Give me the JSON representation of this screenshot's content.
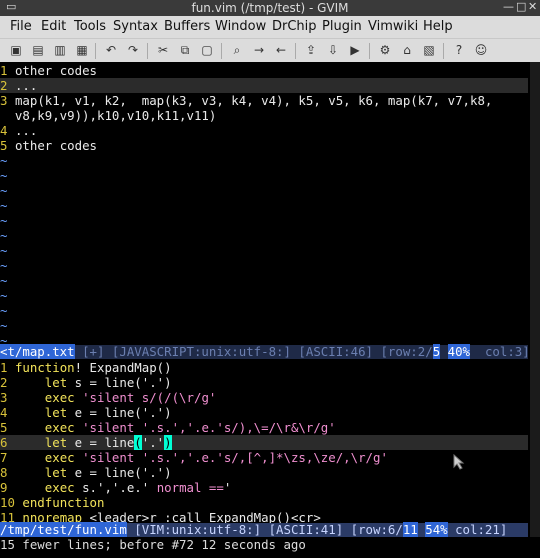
{
  "window": {
    "title": "fun.vim (/tmp/test) - GVIM"
  },
  "menus": [
    "File",
    "Edit",
    "Tools",
    "Syntax",
    "Buffers",
    "Window",
    "DrChip",
    "Plugin",
    "Vimwiki",
    "Help"
  ],
  "toolbar": {
    "icons": [
      "open-file-icon",
      "save-icon",
      "save-all-icon",
      "print-icon",
      "undo-icon",
      "redo-icon",
      "cut-icon",
      "copy-icon",
      "paste-icon",
      "find-icon",
      "find-next-icon",
      "find-prev-icon",
      "load-session-icon",
      "save-session-icon",
      "run-script-icon",
      "make-icon",
      "tag-icon",
      "help-icon",
      "find-help-icon"
    ]
  },
  "top_buffer": {
    "lines": [
      {
        "n": "1",
        "text": "other codes"
      },
      {
        "n": "2",
        "text": "..."
      },
      {
        "n": "3",
        "text": "map(k1, v1, k2,  map(k3, v3, k4, v4), k5, v5, k6, map(k7, v7,k8,"
      },
      {
        "n": "",
        "text": "v8,k9,v9)),k10,v10,k11,v11)"
      },
      {
        "n": "4",
        "text": "..."
      },
      {
        "n": "5",
        "text": "other codes"
      }
    ],
    "tilde": "~",
    "status_left": "<t/map.txt",
    "status_mid": "[+] [JAVASCRIPT:unix:utf-8:] [ASCII:46] [row:2/",
    "status_row": "5",
    "status_pct": "40%",
    "status_col": "col:3]"
  },
  "bottom_buffer": {
    "lines": [
      {
        "n": "1",
        "parts": [
          {
            "t": "function",
            "c": "kw"
          },
          {
            "t": "! ExpandMap()"
          }
        ]
      },
      {
        "n": "2",
        "parts": [
          {
            "t": "    let",
            "c": "kw"
          },
          {
            "t": " s = line('.')"
          }
        ]
      },
      {
        "n": "3",
        "parts": [
          {
            "t": "    exec",
            "c": "kw"
          },
          {
            "t": " 'silent s/(/(\\r/g'",
            "c": "str"
          }
        ]
      },
      {
        "n": "4",
        "parts": [
          {
            "t": "    let",
            "c": "kw"
          },
          {
            "t": " e = line('.')"
          }
        ]
      },
      {
        "n": "5",
        "parts": [
          {
            "t": "    exec",
            "c": "kw"
          },
          {
            "t": " 'silent '.s.','.e.'s/),\\=/\\r&\\r/g'",
            "c": "str"
          }
        ]
      },
      {
        "n": "6",
        "parts": [
          {
            "t": "    let",
            "c": "kw"
          },
          {
            "t": " e = line"
          },
          {
            "t": "(",
            "c": "cursor"
          },
          {
            "t": "'.'"
          },
          {
            "t": ")",
            "c": "cursor"
          }
        ]
      },
      {
        "n": "7",
        "parts": [
          {
            "t": "    exec",
            "c": "kw"
          },
          {
            "t": " 'silent '.s.','.e.'s/,[^,]*\\zs,\\ze/,\\r/g'",
            "c": "str"
          }
        ]
      },
      {
        "n": "8",
        "parts": [
          {
            "t": "    let",
            "c": "kw"
          },
          {
            "t": " e = line('.')"
          }
        ]
      },
      {
        "n": "9",
        "parts": [
          {
            "t": "    exec",
            "c": "kw"
          },
          {
            "t": " s.','.e.' "
          },
          {
            "t": "normal ==",
            "c": "normal"
          },
          {
            "t": "'"
          }
        ]
      },
      {
        "n": "10",
        "parts": [
          {
            "t": "endfunction",
            "c": "kw"
          }
        ]
      },
      {
        "n": "11",
        "parts": [
          {
            "t": "nnoremap",
            "c": "kw"
          },
          {
            "t": " <leader>r :call ExpandMap()<cr>"
          }
        ]
      }
    ],
    "status_left": "/tmp/test/fun.vim",
    "status_mid": " [VIM:unix:utf-8:] [ASCII:41] [row:6/",
    "status_row": "11",
    "status_pct": "54%",
    "status_col": " col:21]"
  },
  "cmdline": "15 fewer lines; before #72  12 seconds ago"
}
